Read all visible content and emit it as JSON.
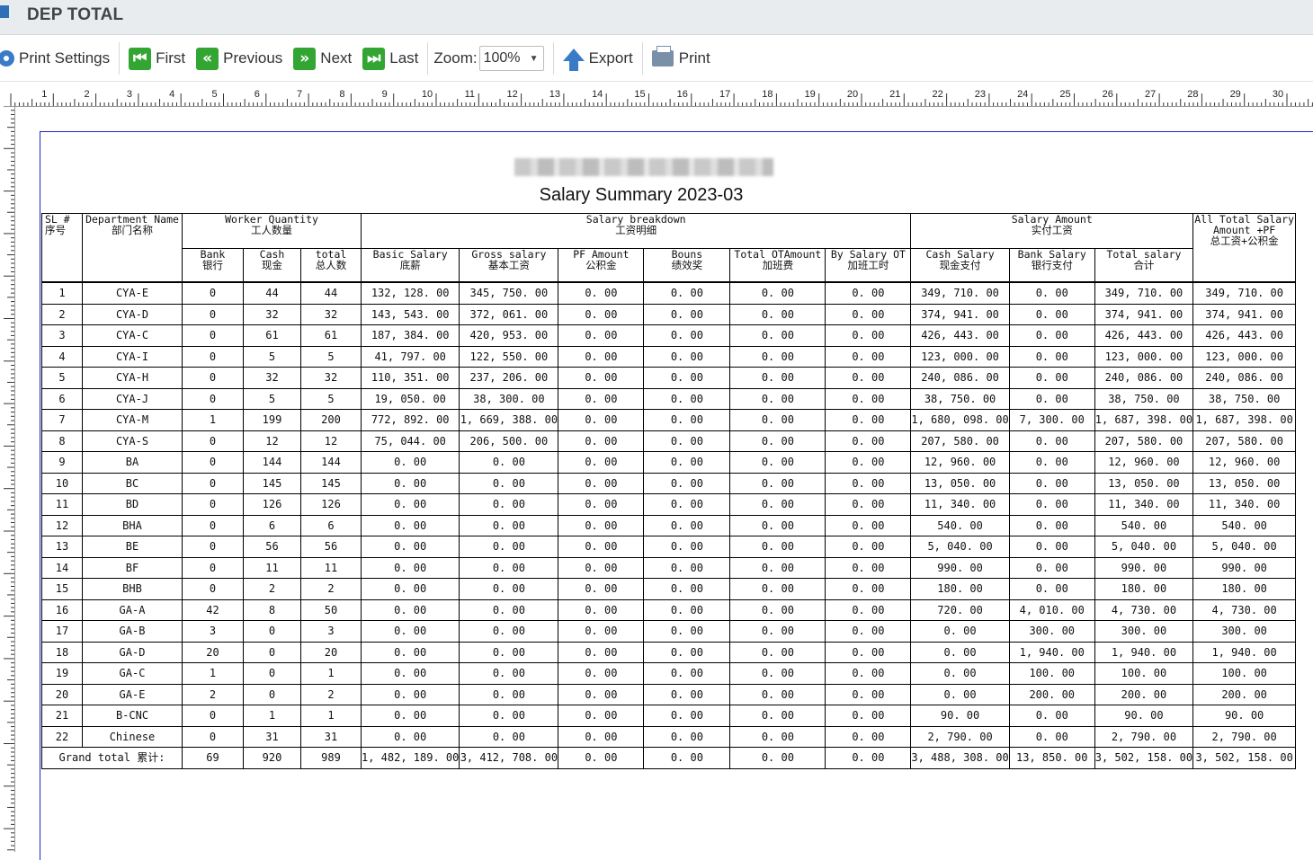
{
  "window": {
    "title": "DEP TOTAL"
  },
  "toolbar": {
    "print_settings": "Print Settings",
    "first": "First",
    "previous": "Previous",
    "next": "Next",
    "last": "Last",
    "zoom_label": "Zoom:",
    "zoom_value": "100%",
    "export": "Export",
    "print": "Print"
  },
  "ruler": {
    "marks": [
      "1",
      "2",
      "3",
      "4",
      "5",
      "6",
      "7",
      "8",
      "9",
      "10",
      "11",
      "12",
      "13",
      "14",
      "15",
      "16",
      "17",
      "18",
      "19",
      "20",
      "21",
      "22",
      "23",
      "24",
      "25",
      "26",
      "27",
      "28",
      "29",
      "30"
    ]
  },
  "report": {
    "title": "Salary Summary 2023-03",
    "headers": {
      "sl_en": "SL #",
      "sl_cn": "序号",
      "dept_en": "Department Name",
      "dept_cn": "部门名称",
      "worker_qty_en": "Worker Quantity",
      "worker_qty_cn": "工人数量",
      "breakdown_en": "Salary breakdown",
      "breakdown_cn": "工资明细",
      "amount_en": "Salary Amount",
      "amount_cn": "实付工资",
      "alltotal_en": "All Total Salary Amount +PF",
      "alltotal_cn": "总工资+公积金",
      "bank_en": "Bank",
      "bank_cn": "银行",
      "cash_en": "Cash",
      "cash_cn": "现金",
      "total_en": "total",
      "total_cn": "总人数",
      "basic_en": "Basic Salary",
      "basic_cn": "底薪",
      "gross_en": "Gross salary",
      "gross_cn": "基本工资",
      "pf_en": "PF Amount",
      "pf_cn": "公积金",
      "bonus_en": "Bouns",
      "bonus_cn": "绩效奖",
      "totalot_en": "Total OTAmount",
      "totalot_cn": "加班费",
      "byot_en": "By Salary OT",
      "byot_cn": "加班工时",
      "cashsal_en": "Cash Salary",
      "cashsal_cn": "现金支付",
      "banksal_en": "Bank Salary",
      "banksal_cn": "银行支付",
      "totalsal_en": "Total salary",
      "totalsal_cn": "合计"
    },
    "rows": [
      [
        "1",
        "CYA-E",
        "0",
        "44",
        "44",
        "132, 128. 00",
        "345, 750. 00",
        "0. 00",
        "0. 00",
        "0. 00",
        "0. 00",
        "349, 710. 00",
        "0. 00",
        "349, 710. 00",
        "349, 710. 00"
      ],
      [
        "2",
        "CYA-D",
        "0",
        "32",
        "32",
        "143, 543. 00",
        "372, 061. 00",
        "0. 00",
        "0. 00",
        "0. 00",
        "0. 00",
        "374, 941. 00",
        "0. 00",
        "374, 941. 00",
        "374, 941. 00"
      ],
      [
        "3",
        "CYA-C",
        "0",
        "61",
        "61",
        "187, 384. 00",
        "420, 953. 00",
        "0. 00",
        "0. 00",
        "0. 00",
        "0. 00",
        "426, 443. 00",
        "0. 00",
        "426, 443. 00",
        "426, 443. 00"
      ],
      [
        "4",
        "CYA-I",
        "0",
        "5",
        "5",
        "41, 797. 00",
        "122, 550. 00",
        "0. 00",
        "0. 00",
        "0. 00",
        "0. 00",
        "123, 000. 00",
        "0. 00",
        "123, 000. 00",
        "123, 000. 00"
      ],
      [
        "5",
        "CYA-H",
        "0",
        "32",
        "32",
        "110, 351. 00",
        "237, 206. 00",
        "0. 00",
        "0. 00",
        "0. 00",
        "0. 00",
        "240, 086. 00",
        "0. 00",
        "240, 086. 00",
        "240, 086. 00"
      ],
      [
        "6",
        "CYA-J",
        "0",
        "5",
        "5",
        "19, 050. 00",
        "38, 300. 00",
        "0. 00",
        "0. 00",
        "0. 00",
        "0. 00",
        "38, 750. 00",
        "0. 00",
        "38, 750. 00",
        "38, 750. 00"
      ],
      [
        "7",
        "CYA-M",
        "1",
        "199",
        "200",
        "772, 892. 00",
        "1, 669, 388. 00",
        "0. 00",
        "0. 00",
        "0. 00",
        "0. 00",
        "1, 680, 098. 00",
        "7, 300. 00",
        "1, 687, 398. 00",
        "1, 687, 398. 00"
      ],
      [
        "8",
        "CYA-S",
        "0",
        "12",
        "12",
        "75, 044. 00",
        "206, 500. 00",
        "0. 00",
        "0. 00",
        "0. 00",
        "0. 00",
        "207, 580. 00",
        "0. 00",
        "207, 580. 00",
        "207, 580. 00"
      ],
      [
        "9",
        "BA",
        "0",
        "144",
        "144",
        "0. 00",
        "0. 00",
        "0. 00",
        "0. 00",
        "0. 00",
        "0. 00",
        "12, 960. 00",
        "0. 00",
        "12, 960. 00",
        "12, 960. 00"
      ],
      [
        "10",
        "BC",
        "0",
        "145",
        "145",
        "0. 00",
        "0. 00",
        "0. 00",
        "0. 00",
        "0. 00",
        "0. 00",
        "13, 050. 00",
        "0. 00",
        "13, 050. 00",
        "13, 050. 00"
      ],
      [
        "11",
        "BD",
        "0",
        "126",
        "126",
        "0. 00",
        "0. 00",
        "0. 00",
        "0. 00",
        "0. 00",
        "0. 00",
        "11, 340. 00",
        "0. 00",
        "11, 340. 00",
        "11, 340. 00"
      ],
      [
        "12",
        "BHA",
        "0",
        "6",
        "6",
        "0. 00",
        "0. 00",
        "0. 00",
        "0. 00",
        "0. 00",
        "0. 00",
        "540. 00",
        "0. 00",
        "540. 00",
        "540. 00"
      ],
      [
        "13",
        "BE",
        "0",
        "56",
        "56",
        "0. 00",
        "0. 00",
        "0. 00",
        "0. 00",
        "0. 00",
        "0. 00",
        "5, 040. 00",
        "0. 00",
        "5, 040. 00",
        "5, 040. 00"
      ],
      [
        "14",
        "BF",
        "0",
        "11",
        "11",
        "0. 00",
        "0. 00",
        "0. 00",
        "0. 00",
        "0. 00",
        "0. 00",
        "990. 00",
        "0. 00",
        "990. 00",
        "990. 00"
      ],
      [
        "15",
        "BHB",
        "0",
        "2",
        "2",
        "0. 00",
        "0. 00",
        "0. 00",
        "0. 00",
        "0. 00",
        "0. 00",
        "180. 00",
        "0. 00",
        "180. 00",
        "180. 00"
      ],
      [
        "16",
        "GA-A",
        "42",
        "8",
        "50",
        "0. 00",
        "0. 00",
        "0. 00",
        "0. 00",
        "0. 00",
        "0. 00",
        "720. 00",
        "4, 010. 00",
        "4, 730. 00",
        "4, 730. 00"
      ],
      [
        "17",
        "GA-B",
        "3",
        "0",
        "3",
        "0. 00",
        "0. 00",
        "0. 00",
        "0. 00",
        "0. 00",
        "0. 00",
        "0. 00",
        "300. 00",
        "300. 00",
        "300. 00"
      ],
      [
        "18",
        "GA-D",
        "20",
        "0",
        "20",
        "0. 00",
        "0. 00",
        "0. 00",
        "0. 00",
        "0. 00",
        "0. 00",
        "0. 00",
        "1, 940. 00",
        "1, 940. 00",
        "1, 940. 00"
      ],
      [
        "19",
        "GA-C",
        "1",
        "0",
        "1",
        "0. 00",
        "0. 00",
        "0. 00",
        "0. 00",
        "0. 00",
        "0. 00",
        "0. 00",
        "100. 00",
        "100. 00",
        "100. 00"
      ],
      [
        "20",
        "GA-E",
        "2",
        "0",
        "2",
        "0. 00",
        "0. 00",
        "0. 00",
        "0. 00",
        "0. 00",
        "0. 00",
        "0. 00",
        "200. 00",
        "200. 00",
        "200. 00"
      ],
      [
        "21",
        "B-CNC",
        "0",
        "1",
        "1",
        "0. 00",
        "0. 00",
        "0. 00",
        "0. 00",
        "0. 00",
        "0. 00",
        "90. 00",
        "0. 00",
        "90. 00",
        "90. 00"
      ],
      [
        "22",
        "Chinese",
        "0",
        "31",
        "31",
        "0. 00",
        "0. 00",
        "0. 00",
        "0. 00",
        "0. 00",
        "0. 00",
        "2, 790. 00",
        "0. 00",
        "2, 790. 00",
        "2, 790. 00"
      ]
    ],
    "grand_total": {
      "label": "Grand total 累计:",
      "values": [
        "69",
        "920",
        "989",
        "1, 482, 189. 00",
        "3, 412, 708. 00",
        "0. 00",
        "0. 00",
        "0. 00",
        "0. 00",
        "3, 488, 308. 00",
        "13, 850. 00",
        "3, 502, 158. 00",
        "3, 502, 158. 00"
      ]
    }
  }
}
